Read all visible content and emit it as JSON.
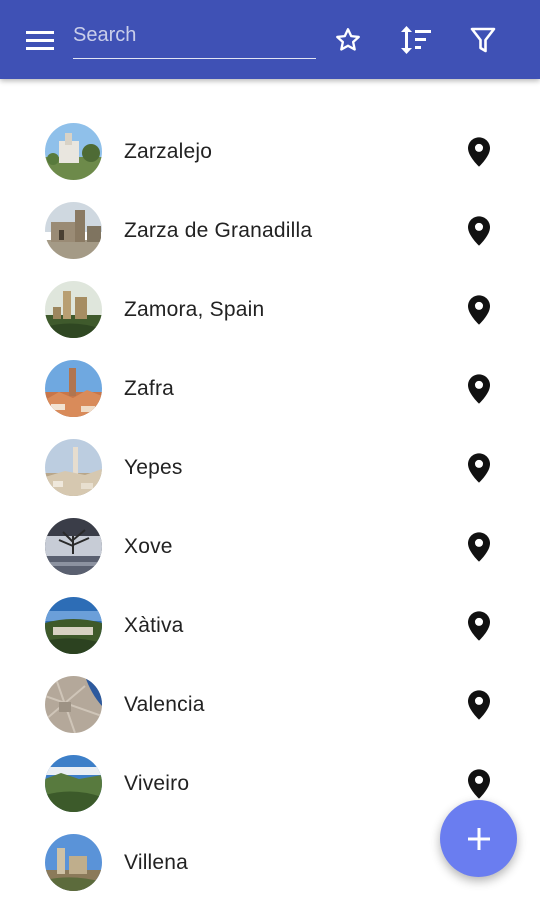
{
  "colors": {
    "appbar": "#3f51b5",
    "fab": "#6a7df0",
    "icon_dark": "#111111",
    "text": "#222222"
  },
  "header": {
    "menu_icon": "menu-icon",
    "search": {
      "placeholder": "Search",
      "value": ""
    },
    "actions": [
      "star-outline-icon",
      "sort-icon",
      "filter-icon"
    ]
  },
  "places": [
    {
      "name": "Zarzalejo",
      "icon": "map-marker-icon"
    },
    {
      "name": "Zarza de Granadilla",
      "icon": "map-marker-icon"
    },
    {
      "name": "Zamora, Spain",
      "icon": "map-marker-icon"
    },
    {
      "name": "Zafra",
      "icon": "map-marker-icon"
    },
    {
      "name": "Yepes",
      "icon": "map-marker-icon"
    },
    {
      "name": "Xove",
      "icon": "map-marker-icon"
    },
    {
      "name": "Xàtiva",
      "icon": "map-marker-icon"
    },
    {
      "name": "Valencia",
      "icon": "map-marker-icon"
    },
    {
      "name": "Viveiro",
      "icon": "map-marker-icon"
    },
    {
      "name": "Villena",
      "icon": "map-marker-icon"
    }
  ],
  "fab": {
    "icon": "plus-icon"
  }
}
